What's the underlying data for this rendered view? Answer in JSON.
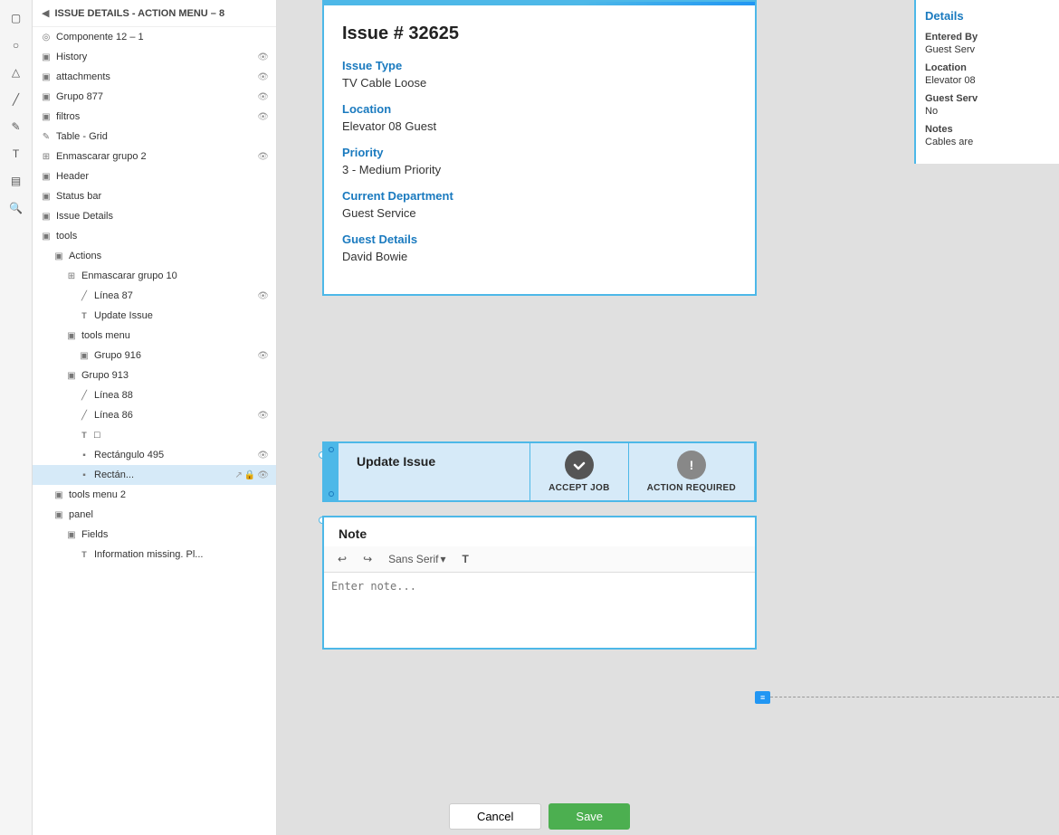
{
  "header": {
    "title": "ISSUE DETAILS - ACTION MENU – 8",
    "back_label": "◀"
  },
  "layers": {
    "items": [
      {
        "id": "componente",
        "name": "Componente 12 – 1",
        "icon": "◎",
        "indent": 0,
        "has_eye": false
      },
      {
        "id": "history",
        "name": "History",
        "icon": "▣",
        "indent": 0,
        "has_eye": true
      },
      {
        "id": "attachments",
        "name": "attachments",
        "icon": "▣",
        "indent": 0,
        "has_eye": true
      },
      {
        "id": "grupo877",
        "name": "Grupo 877",
        "icon": "▣",
        "indent": 0,
        "has_eye": true
      },
      {
        "id": "filtros",
        "name": "filtros",
        "icon": "▣",
        "indent": 0,
        "has_eye": true
      },
      {
        "id": "table-grid",
        "name": "Table - Grid",
        "icon": "✏",
        "indent": 0,
        "has_eye": false
      },
      {
        "id": "enmascarar2",
        "name": "Enmascarar grupo 2",
        "icon": "⊞",
        "indent": 0,
        "has_eye": true
      },
      {
        "id": "header",
        "name": "Header",
        "icon": "▣",
        "indent": 0,
        "has_eye": false
      },
      {
        "id": "statusbar",
        "name": "Status bar",
        "icon": "▣",
        "indent": 0,
        "has_eye": false
      },
      {
        "id": "issuedetails",
        "name": "Issue Details",
        "icon": "▣",
        "indent": 0,
        "has_eye": false
      },
      {
        "id": "tools",
        "name": "tools",
        "icon": "▣",
        "indent": 0,
        "has_eye": false
      },
      {
        "id": "actions",
        "name": "Actions",
        "icon": "▣",
        "indent": 1,
        "has_eye": false
      },
      {
        "id": "enmascarar10",
        "name": "Enmascarar grupo 10",
        "icon": "⊞",
        "indent": 2,
        "has_eye": false
      },
      {
        "id": "linea87",
        "name": "Línea 87",
        "icon": "╱",
        "indent": 3,
        "has_eye": true
      },
      {
        "id": "updateissue",
        "name": "Update Issue",
        "icon": "T",
        "indent": 3,
        "has_eye": false
      },
      {
        "id": "toolsmenu",
        "name": "tools menu",
        "icon": "▣",
        "indent": 2,
        "has_eye": false
      },
      {
        "id": "grupo916",
        "name": "Grupo 916",
        "icon": "▣",
        "indent": 3,
        "has_eye": true
      },
      {
        "id": "grupo913",
        "name": "Grupo 913",
        "icon": "▣",
        "indent": 2,
        "has_eye": false
      },
      {
        "id": "linea88",
        "name": "Línea 88",
        "icon": "╱",
        "indent": 3,
        "has_eye": false
      },
      {
        "id": "linea86",
        "name": "Línea 86",
        "icon": "╱",
        "indent": 3,
        "has_eye": true
      },
      {
        "id": "textbox",
        "name": "□",
        "icon": "T",
        "indent": 3,
        "has_eye": false
      },
      {
        "id": "rectangulo495",
        "name": "Rectángulo 495",
        "icon": "▪",
        "indent": 3,
        "has_eye": true
      },
      {
        "id": "rectSelected",
        "name": "Rectán...",
        "icon": "▪",
        "indent": 3,
        "has_eye": false,
        "selected": true,
        "has_actions": true
      },
      {
        "id": "toolsmenu2",
        "name": "tools menu 2",
        "icon": "▣",
        "indent": 1,
        "has_eye": false
      },
      {
        "id": "panel",
        "name": "panel",
        "icon": "▣",
        "indent": 1,
        "has_eye": false
      },
      {
        "id": "fields",
        "name": "Fields",
        "icon": "▣",
        "indent": 2,
        "has_eye": false
      },
      {
        "id": "infomissing",
        "name": "Information missing. Pl...",
        "icon": "T",
        "indent": 3,
        "has_eye": false
      }
    ]
  },
  "toolbar": {
    "icons": [
      "▢",
      "○",
      "△",
      "╱",
      "✎",
      "T",
      "▤",
      "🔍"
    ]
  },
  "issue": {
    "number": "Issue # 32625",
    "type_label": "Issue Type",
    "type_value": "TV Cable Loose",
    "location_label": "Location",
    "location_value": "Elevator 08 Guest",
    "priority_label": "Priority",
    "priority_value": "3 - Medium Priority",
    "department_label": "Current Department",
    "department_value": "Guest Service",
    "guest_label": "Guest Details",
    "guest_value": "David Bowie"
  },
  "update_issue": {
    "label": "Update Issue",
    "accept_job_label": "ACCEPT JOB",
    "action_required_label": "ACTION REQUIRED"
  },
  "note": {
    "label": "Note",
    "toolbar": {
      "undo": "↩",
      "redo": "↪",
      "font": "Sans Serif",
      "dropdown": "▾",
      "t_label": "T"
    }
  },
  "details": {
    "title": "Details",
    "entered_by_label": "Entered By",
    "entered_by_value": "Guest Serv",
    "location_label": "Location",
    "location_value": "Elevator 08",
    "guest_service_label": "Guest Serv",
    "guest_service_value": "No",
    "notes_label": "Notes",
    "notes_value": "Cables are"
  },
  "footer": {
    "cancel_label": "Cancel",
    "save_label": "Save"
  },
  "colors": {
    "accent": "#4db8e8",
    "blue_text": "#1a7abf",
    "selected_bg": "#d6eaf8"
  }
}
